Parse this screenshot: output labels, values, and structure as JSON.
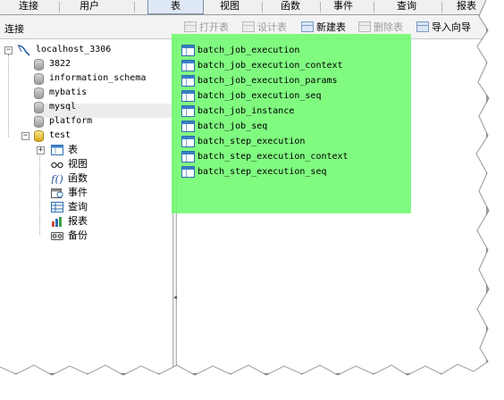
{
  "tabs": [
    {
      "label": "连接",
      "active": false
    },
    {
      "label": "用户",
      "active": false
    },
    {
      "label": "表",
      "active": true
    },
    {
      "label": "视图",
      "active": false
    },
    {
      "label": "函数",
      "active": false
    },
    {
      "label": "事件",
      "active": false
    },
    {
      "label": "查询",
      "active": false
    },
    {
      "label": "报表",
      "active": false
    }
  ],
  "toolbar": {
    "section_label": "连接",
    "open_table": "打开表",
    "design_table": "设计表",
    "new_table": "新建表",
    "delete_table": "删除表",
    "import_wizard": "导入向导"
  },
  "tree": {
    "connection": "localhost_3306",
    "databases": [
      "3822",
      "information_schema",
      "mybatis",
      "mysql",
      "platform",
      "test"
    ],
    "children": [
      "表",
      "视图",
      "函数",
      "事件",
      "查询",
      "报表",
      "备份"
    ]
  },
  "tables": [
    "batch_job_execution",
    "batch_job_execution_context",
    "batch_job_execution_params",
    "batch_job_execution_seq",
    "batch_job_instance",
    "batch_job_seq",
    "batch_step_execution",
    "batch_step_execution_context",
    "batch_step_execution_seq"
  ],
  "colors": {
    "highlight": "#6efa6e",
    "tab_active_bg": "#dfe8f5",
    "table_icon": "#3a7fc6"
  }
}
